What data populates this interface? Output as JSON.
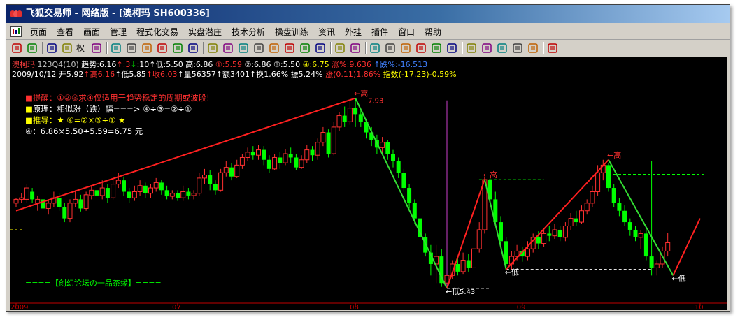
{
  "window": {
    "title": "飞狐交易师 - 网络版 - [澳柯玛 SH600336]"
  },
  "menu": [
    "页面",
    "查看",
    "画面",
    "管理",
    "程式化交易",
    "实盘潜庄",
    "技术分析",
    "操盘训练",
    "资讯",
    "外挂",
    "插件",
    "窗口",
    "帮助"
  ],
  "toolbar": {
    "icons": [
      "open-icon",
      "rsi-icon",
      "move-icon",
      "arrows-icon",
      "weight-icon",
      "candles-icon",
      "chart-icon",
      "copy-icon",
      "book-icon",
      "grid-icon",
      "gear-icon",
      "alarm-icon",
      "ruler-icon",
      "table-icon",
      "list-icon",
      "layout-icon",
      "window-icon",
      "calendar-icon",
      "window2-icon",
      "pointer-icon",
      "line-icon",
      "channel-icon",
      "vlines-icon",
      "fan-icon",
      "gann-icon",
      "parallel-icon",
      "rect-icon",
      "ellipse-icon",
      "text-icon",
      "copy2-icon",
      "eraser-icon",
      "palette-icon",
      "save-icon"
    ],
    "weight_label": "权"
  },
  "header": {
    "line1": [
      {
        "text": "澳柯玛 ",
        "color": "#ff4040"
      },
      {
        "text": "123Q4(10) ",
        "color": "#c0c0c0"
      },
      {
        "text": "趋势:6.16",
        "color": "#ffffff"
      },
      {
        "text": "↑",
        "color": "#ff3030"
      },
      {
        "text": ":3",
        "color": "#ff3030"
      },
      {
        "text": "↓",
        "color": "#00ff00"
      },
      {
        "text": ":10",
        "color": "#ffffff"
      },
      {
        "text": "↑低:5.50 ",
        "color": "#ffffff"
      },
      {
        "text": "高:6.86 ",
        "color": "#ffffff"
      },
      {
        "text": "①:5.59 ",
        "color": "#ff3030"
      },
      {
        "text": "②:6.86 ",
        "color": "#ffffff"
      },
      {
        "text": "③:5.50 ",
        "color": "#ffffff"
      },
      {
        "text": "④:6.75 ",
        "color": "#ffff00"
      },
      {
        "text": "涨%:9.636 ",
        "color": "#ff3030"
      },
      {
        "text": "↑跌%:-16.513",
        "color": "#4080ff"
      }
    ],
    "line2": [
      {
        "text": "2009/10/12 ",
        "color": "#ffffff"
      },
      {
        "text": "开5.92",
        "color": "#ffffff"
      },
      {
        "text": "↑高6.16",
        "color": "#ff3030"
      },
      {
        "text": "↑低5.85",
        "color": "#ffffff"
      },
      {
        "text": "↑收6.03",
        "color": "#ff3030"
      },
      {
        "text": "↑量56357",
        "color": "#ffffff"
      },
      {
        "text": "↑额3401",
        "color": "#ffffff"
      },
      {
        "text": "↑换1.66% ",
        "color": "#ffffff"
      },
      {
        "text": "振5.24% ",
        "color": "#ffffff"
      },
      {
        "text": "涨(0.11)1.86% ",
        "color": "#ff3030"
      },
      {
        "text": "指数(-17.23)-0.59%",
        "color": "#ffff00"
      }
    ]
  },
  "notes": [
    {
      "bullet": "■",
      "bullet_color": "#ff3030",
      "text": "提醒：①②③求④仅适用于趋势稳定的周期或波段!",
      "color": "#ff3030"
    },
    {
      "bullet": "■",
      "bullet_color": "#ffff00",
      "text": "原理：相似涨（跌）幅===> ④÷③=②÷①",
      "color": "#ffffff"
    },
    {
      "bullet": "■",
      "bullet_color": "#ffff00",
      "text": "推导：★ ④=②×③÷① ★",
      "color": "#ffff00"
    },
    {
      "bullet": "",
      "bullet_color": "#ffffff",
      "text": "④：6.86×5.50÷5.59=6.75 元",
      "color": "#ffffff"
    }
  ],
  "footer_note": "====【创幻论坛の一品茶缘】====",
  "chart_data": {
    "type": "candlestick",
    "y_range": [
      5.3,
      8.1
    ],
    "x_labels": [
      {
        "index": 0,
        "label": "2009"
      },
      {
        "index": 30,
        "label": "07"
      },
      {
        "index": 63,
        "label": "08"
      },
      {
        "index": 94,
        "label": "09"
      },
      {
        "index": 127,
        "label": "10"
      }
    ],
    "price_labels": [
      {
        "index": 63,
        "price": 7.93,
        "text": "←高",
        "value_text": "7.93"
      },
      {
        "index": 80,
        "price": 5.43,
        "text": "←低",
        "value_text": "5.43"
      },
      {
        "index": 87,
        "price": 6.86,
        "text": "←高"
      },
      {
        "index": 91,
        "price": 5.68,
        "text": "←低"
      },
      {
        "index": 110,
        "price": 7.12,
        "text": "←高"
      },
      {
        "index": 122,
        "price": 5.6,
        "text": "←低"
      }
    ],
    "candles": [
      [
        6.55,
        6.6,
        6.5,
        6.62
      ],
      [
        6.6,
        6.62,
        6.55,
        6.68
      ],
      [
        6.6,
        6.75,
        6.55,
        6.8
      ],
      [
        6.7,
        6.6,
        6.55,
        6.75
      ],
      [
        6.55,
        6.6,
        6.45,
        6.65
      ],
      [
        6.6,
        6.48,
        6.44,
        6.65
      ],
      [
        6.48,
        6.55,
        6.4,
        6.6
      ],
      [
        6.55,
        6.62,
        6.5,
        6.7
      ],
      [
        6.62,
        6.5,
        6.45,
        6.68
      ],
      [
        6.5,
        6.35,
        6.3,
        6.55
      ],
      [
        6.35,
        6.55,
        6.3,
        6.6
      ],
      [
        6.55,
        6.6,
        6.5,
        6.72
      ],
      [
        6.6,
        6.48,
        6.44,
        6.66
      ],
      [
        6.48,
        6.66,
        6.45,
        6.7
      ],
      [
        6.65,
        6.72,
        6.6,
        6.78
      ],
      [
        6.72,
        6.65,
        6.6,
        6.8
      ],
      [
        6.65,
        6.75,
        6.6,
        6.85
      ],
      [
        6.75,
        6.62,
        6.55,
        6.8
      ],
      [
        6.62,
        6.8,
        6.6,
        6.88
      ],
      [
        6.8,
        6.85,
        6.75,
        6.95
      ],
      [
        6.85,
        6.7,
        6.65,
        6.9
      ],
      [
        6.7,
        6.62,
        6.55,
        6.75
      ],
      [
        6.62,
        6.7,
        6.58,
        6.78
      ],
      [
        6.7,
        6.78,
        6.65,
        6.85
      ],
      [
        6.78,
        6.68,
        6.62,
        6.82
      ],
      [
        6.68,
        6.75,
        6.62,
        6.8
      ],
      [
        6.75,
        6.82,
        6.7,
        6.88
      ],
      [
        6.82,
        6.72,
        6.66,
        6.86
      ],
      [
        6.72,
        6.64,
        6.6,
        6.78
      ],
      [
        6.64,
        6.68,
        6.6,
        6.72
      ],
      [
        6.68,
        6.62,
        6.58,
        6.72
      ],
      [
        6.62,
        6.7,
        6.58,
        6.78
      ],
      [
        6.7,
        6.65,
        6.6,
        6.75
      ],
      [
        6.65,
        6.68,
        6.6,
        6.72
      ],
      [
        6.68,
        6.88,
        6.65,
        6.95
      ],
      [
        6.88,
        6.92,
        6.8,
        7.0
      ],
      [
        6.92,
        6.8,
        6.72,
        6.98
      ],
      [
        6.8,
        6.72,
        6.66,
        6.85
      ],
      [
        6.72,
        6.95,
        6.7,
        7.0
      ],
      [
        6.95,
        7.02,
        6.9,
        7.1
      ],
      [
        7.02,
        6.9,
        6.85,
        7.08
      ],
      [
        6.9,
        7.05,
        6.88,
        7.12
      ],
      [
        7.05,
        7.15,
        7.0,
        7.2
      ],
      [
        7.15,
        7.22,
        7.1,
        7.28
      ],
      [
        7.22,
        7.18,
        7.12,
        7.3
      ],
      [
        7.18,
        7.25,
        7.12,
        7.32
      ],
      [
        7.25,
        7.12,
        7.05,
        7.3
      ],
      [
        7.12,
        7.0,
        6.95,
        7.18
      ],
      [
        7.0,
        7.15,
        6.98,
        7.2
      ],
      [
        7.15,
        7.08,
        7.0,
        7.22
      ],
      [
        7.08,
        7.2,
        7.05,
        7.26
      ],
      [
        7.2,
        7.15,
        7.08,
        7.28
      ],
      [
        7.15,
        7.02,
        6.98,
        7.2
      ],
      [
        7.02,
        7.12,
        7.0,
        7.18
      ],
      [
        7.12,
        7.25,
        7.08,
        7.32
      ],
      [
        7.25,
        7.18,
        7.1,
        7.3
      ],
      [
        7.18,
        7.35,
        7.12,
        7.4
      ],
      [
        7.35,
        7.48,
        7.3,
        7.55
      ],
      [
        7.48,
        7.2,
        7.15,
        7.52
      ],
      [
        7.2,
        7.55,
        7.18,
        7.62
      ],
      [
        7.55,
        7.7,
        7.5,
        7.75
      ],
      [
        7.7,
        7.62,
        7.55,
        7.82
      ],
      [
        7.62,
        7.8,
        7.58,
        7.9
      ],
      [
        7.8,
        7.72,
        7.55,
        7.93
      ],
      [
        7.72,
        7.62,
        7.55,
        7.78
      ],
      [
        7.62,
        7.48,
        7.4,
        7.66
      ],
      [
        7.48,
        7.38,
        7.3,
        7.55
      ],
      [
        7.38,
        7.28,
        7.2,
        7.45
      ],
      [
        7.28,
        7.35,
        7.2,
        7.42
      ],
      [
        7.35,
        7.2,
        7.12,
        7.38
      ],
      [
        7.2,
        7.1,
        7.02,
        7.25
      ],
      [
        7.1,
        6.95,
        6.88,
        7.15
      ],
      [
        6.95,
        6.75,
        6.7,
        7.0
      ],
      [
        6.75,
        6.55,
        6.48,
        6.8
      ],
      [
        6.55,
        6.35,
        6.28,
        6.6
      ],
      [
        6.35,
        6.1,
        6.05,
        6.4
      ],
      [
        6.1,
        5.9,
        5.85,
        6.15
      ],
      [
        5.9,
        5.75,
        5.6,
        6.0
      ],
      [
        5.75,
        5.85,
        5.5,
        6.0
      ],
      [
        5.85,
        5.5,
        5.45,
        5.95
      ],
      [
        5.5,
        5.6,
        5.43,
        7.9
      ],
      [
        5.6,
        5.75,
        5.55,
        5.8
      ],
      [
        5.75,
        5.65,
        5.6,
        5.85
      ],
      [
        5.65,
        5.8,
        5.62,
        5.9
      ],
      [
        5.8,
        5.7,
        5.65,
        5.88
      ],
      [
        5.7,
        5.95,
        5.68,
        6.0
      ],
      [
        5.95,
        6.2,
        5.9,
        6.3
      ],
      [
        6.2,
        6.86,
        6.15,
        6.9
      ],
      [
        6.86,
        6.6,
        6.5,
        6.88
      ],
      [
        6.6,
        6.3,
        6.25,
        6.7
      ],
      [
        6.3,
        6.05,
        5.95,
        6.38
      ],
      [
        6.05,
        5.75,
        5.7,
        6.1
      ],
      [
        5.75,
        5.85,
        5.68,
        5.92
      ],
      [
        5.85,
        5.92,
        5.8,
        6.0
      ],
      [
        5.92,
        5.85,
        5.78,
        5.98
      ],
      [
        5.85,
        5.95,
        5.8,
        6.05
      ],
      [
        5.95,
        6.1,
        5.9,
        6.15
      ],
      [
        6.1,
        6.02,
        5.95,
        6.18
      ],
      [
        6.02,
        6.15,
        5.98,
        6.2
      ],
      [
        6.15,
        6.12,
        6.05,
        6.25
      ],
      [
        6.12,
        6.2,
        6.08,
        6.28
      ],
      [
        6.2,
        6.1,
        6.05,
        6.25
      ],
      [
        6.1,
        6.25,
        6.05,
        6.3
      ],
      [
        6.25,
        6.35,
        6.2,
        6.42
      ],
      [
        6.35,
        6.3,
        6.25,
        6.45
      ],
      [
        6.3,
        6.45,
        6.28,
        6.52
      ],
      [
        6.45,
        6.55,
        6.4,
        6.6
      ],
      [
        6.55,
        6.7,
        6.5,
        6.78
      ],
      [
        6.7,
        6.95,
        6.65,
        7.05
      ],
      [
        6.95,
        7.05,
        6.85,
        7.12
      ],
      [
        7.05,
        6.75,
        6.7,
        7.08
      ],
      [
        6.75,
        6.55,
        6.5,
        6.8
      ],
      [
        6.55,
        6.45,
        6.38,
        6.62
      ],
      [
        6.45,
        6.3,
        6.25,
        6.52
      ],
      [
        6.3,
        6.2,
        6.12,
        6.35
      ],
      [
        6.2,
        6.1,
        6.05,
        6.25
      ],
      [
        6.1,
        6.15,
        5.95,
        6.2
      ],
      [
        6.15,
        5.85,
        5.8,
        6.2
      ],
      [
        5.85,
        5.7,
        5.6,
        7.1
      ],
      [
        5.7,
        5.75,
        5.6,
        5.8
      ],
      [
        5.75,
        5.92,
        5.7,
        5.98
      ],
      [
        5.92,
        6.03,
        5.85,
        6.16
      ]
    ]
  }
}
